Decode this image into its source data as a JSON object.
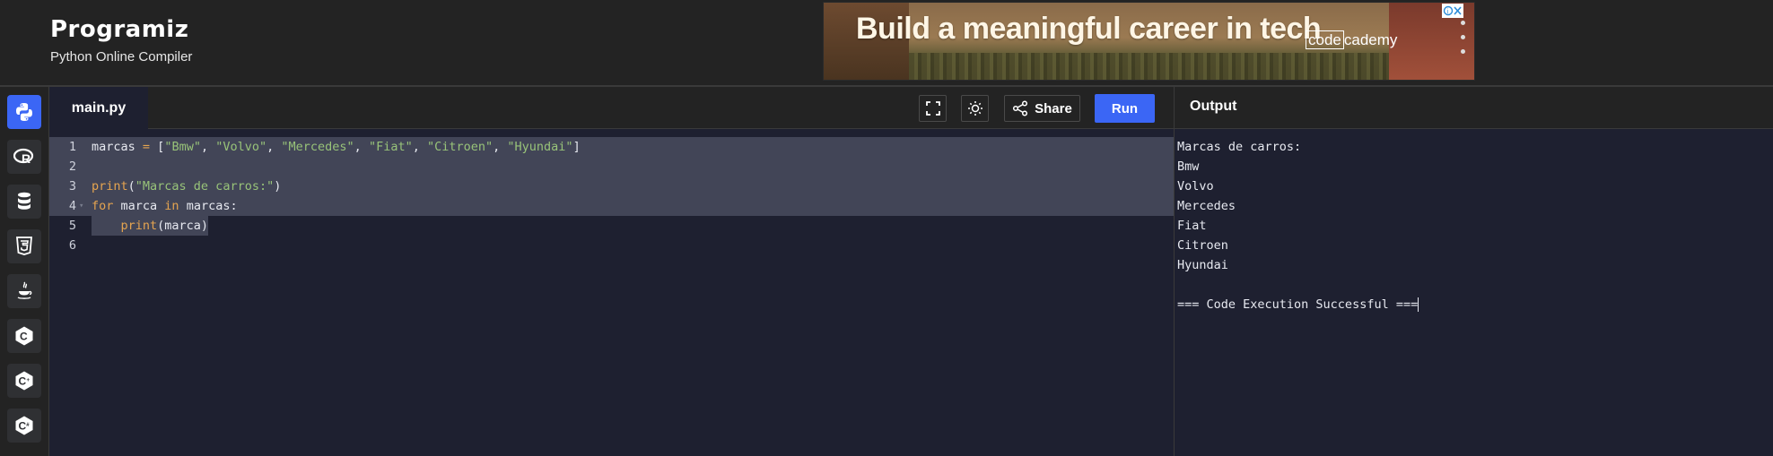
{
  "header": {
    "logo_text": "Programiz",
    "subtitle": "Python Online Compiler",
    "ad": {
      "headline": "Build a meaningful career in tech",
      "brand_box": "code",
      "brand_rest": "cademy"
    }
  },
  "sidebar": {
    "items": [
      {
        "name": "python-icon",
        "active": true
      },
      {
        "name": "r-icon"
      },
      {
        "name": "sql-icon"
      },
      {
        "name": "html5-icon"
      },
      {
        "name": "java-icon"
      },
      {
        "name": "c-icon"
      },
      {
        "name": "cpp-icon"
      },
      {
        "name": "csharp-icon"
      }
    ]
  },
  "editor": {
    "file_tab": "main.py",
    "share_label": "Share",
    "run_label": "Run",
    "line_numbers": [
      "1",
      "2",
      "3",
      "4",
      "5",
      "6"
    ],
    "lines": [
      "marcas = [\"Bmw\", \"Volvo\", \"Mercedes\", \"Fiat\", \"Citroen\", \"Hyundai\"]",
      "",
      "print(\"Marcas de carros:\")",
      "for marca in marcas:",
      "    print(marca)",
      ""
    ]
  },
  "output": {
    "title": "Output",
    "lines": [
      "Marcas de carros:",
      "Bmw",
      "Volvo",
      "Mercedes",
      "Fiat",
      "Citroen",
      "Hyundai",
      "",
      "=== Code Execution Successful ==="
    ]
  },
  "colors": {
    "accent": "#3b66f5",
    "background": "#1e2030",
    "chrome": "#232323",
    "selection": "#424557",
    "string": "#98c379",
    "keyword": "#e5a450"
  }
}
